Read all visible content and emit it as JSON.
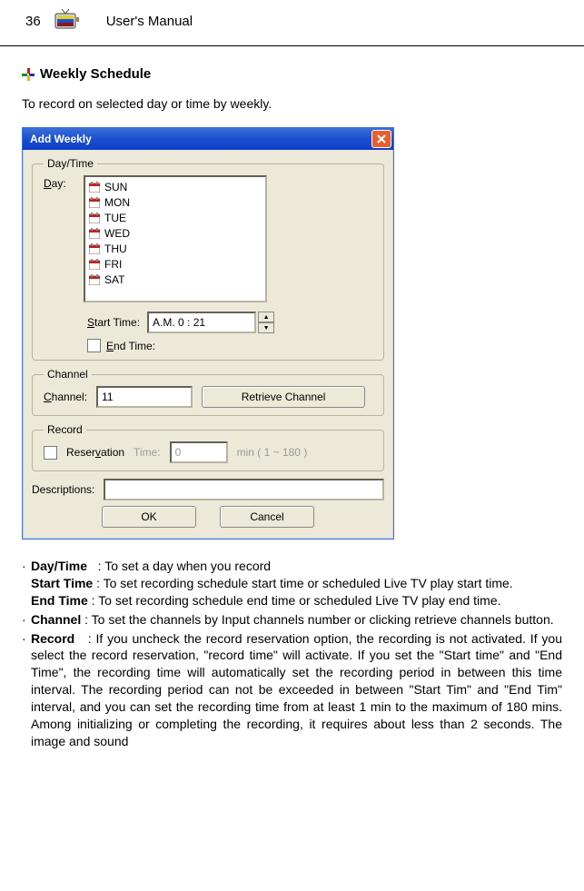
{
  "header": {
    "pageNumber": "36",
    "manual": "User's Manual"
  },
  "section": {
    "title": "Weekly Schedule",
    "intro": "To record on selected day or time by weekly."
  },
  "dialog": {
    "title": "Add Weekly",
    "groups": {
      "daytime": "Day/Time",
      "channel": "Channel",
      "record": "Record"
    },
    "labels": {
      "dayPrefixU": "D",
      "daySuffix": "ay:",
      "startPrefixU": "S",
      "startSuffix": "tart Time:",
      "endPrefixU": "E",
      "endSuffix": "nd Time:",
      "channelPrefixU": "C",
      "channelSuffix": "hannel:",
      "reservPrefix": "Reser",
      "reservU": "v",
      "reservSuffix": "ation",
      "timeLabel": "Time:",
      "minHint": "min ( 1 ~ 180 )",
      "descriptions": "Descriptions:"
    },
    "days": [
      "SUN",
      "MON",
      "TUE",
      "WED",
      "THU",
      "FRI",
      "SAT"
    ],
    "startTimeValue": "A.M. 0 : 21",
    "channelValue": "11",
    "retrieveBtn": "Retrieve Channel",
    "recordTimeValue": "0",
    "ok": "OK",
    "cancel": "Cancel"
  },
  "definitions": [
    {
      "term": "Day/Time",
      "main": ": To set a day when you record",
      "sub": [
        {
          "bold": "Start Time",
          "text": " : To set recording schedule start time or scheduled Live TV play start time."
        },
        {
          "bold": "End Time",
          "text": " : To set recording schedule end time or scheduled Live TV play end time."
        }
      ]
    },
    {
      "term": "Channel",
      "main": " : To set the channels by Input channels number or clicking retrieve channels button."
    },
    {
      "term": "Record",
      "main": " : If you uncheck the record reservation option, the recording is not activated.  If you select the record reservation, \"record time\" will activate.  If you set the \"Start time\" and \"End Time\", the recording time will automatically set the recording period in between this time interval.  The recording period can not be exceeded in between \"Start Tim\" and \"End Tim\" interval, and you can set the recording time from at least 1 min to the maximum of 180 mins.  Among initializing or completing the recording, it requires about less than 2 seconds.  The image and sound"
    }
  ]
}
